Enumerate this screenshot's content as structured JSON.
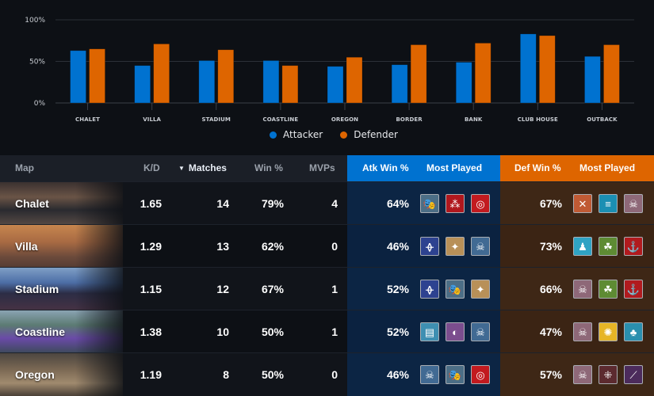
{
  "chart": {
    "legend": [
      {
        "label": "Attacker",
        "color": "#0072d0"
      },
      {
        "label": "Defender",
        "color": "#de6500"
      }
    ]
  },
  "chart_data": {
    "type": "bar",
    "title": "",
    "xlabel": "",
    "ylabel": "",
    "ylim": [
      0,
      100
    ],
    "yticks": [
      "0%",
      "50%",
      "100%"
    ],
    "ytick_values": [
      0,
      50,
      100
    ],
    "grid": true,
    "legend_position": "bottom-center",
    "categories": [
      "CHALET",
      "VILLA",
      "STADIUM",
      "COASTLINE",
      "OREGON",
      "BORDER",
      "BANK",
      "CLUB HOUSE",
      "OUTBACK"
    ],
    "series": [
      {
        "name": "Attacker",
        "color": "#0072d0",
        "values": [
          63,
          45,
          51,
          51,
          44,
          46,
          49,
          83,
          56
        ]
      },
      {
        "name": "Defender",
        "color": "#de6500",
        "values": [
          65,
          71,
          64,
          45,
          55,
          70,
          72,
          81,
          70
        ]
      }
    ]
  },
  "table": {
    "headers": {
      "map": "Map",
      "kd": "K/D",
      "sort_arrow": "▼",
      "matches": "Matches",
      "win": "Win %",
      "mvps": "MVPs",
      "atk_win": "Atk Win %",
      "atk_most": "Most Played",
      "def_win": "Def Win %",
      "def_most": "Most Played"
    },
    "colors": {
      "attack": "#0072d0",
      "defense": "#de6500"
    },
    "rows": [
      {
        "map": "Chalet",
        "kd": "1.65",
        "matches": "14",
        "win": "79%",
        "mvps": "4",
        "atk_win": "64%",
        "def_win": "67%",
        "atk_ops": [
          {
            "name": "masks-operator-icon",
            "glyph": "🎭",
            "bg": "#4c6e86"
          },
          {
            "name": "cluster-charge-operator-icon",
            "glyph": "⁂",
            "bg": "#b0171d"
          },
          {
            "name": "target-operator-icon",
            "glyph": "◎",
            "bg": "#c21a1f"
          }
        ],
        "def_ops": [
          {
            "name": "slash-operator-icon",
            "glyph": "✕",
            "bg": "#c05a34"
          },
          {
            "name": "zipper-operator-icon",
            "glyph": "≡",
            "bg": "#1b8fb3"
          },
          {
            "name": "skull-operator-icon",
            "glyph": "☠",
            "bg": "#8e6878"
          }
        ]
      },
      {
        "map": "Villa",
        "kd": "1.29",
        "matches": "13",
        "win": "62%",
        "mvps": "0",
        "atk_win": "46%",
        "def_win": "73%",
        "atk_ops": [
          {
            "name": "fingerprint-operator-icon",
            "glyph": "ᚖ",
            "bg": "#2d4290"
          },
          {
            "name": "compass-operator-icon",
            "glyph": "✦",
            "bg": "#b89058"
          },
          {
            "name": "drone-skull-operator-icon",
            "glyph": "☠",
            "bg": "#416a93"
          }
        ],
        "def_ops": [
          {
            "name": "silhouette-operator-icon",
            "glyph": "♟",
            "bg": "#2fa3c4"
          },
          {
            "name": "triquetra-operator-icon",
            "glyph": "☘",
            "bg": "#5e8b33"
          },
          {
            "name": "anchor-operator-icon",
            "glyph": "⚓",
            "bg": "#b11a1e"
          }
        ]
      },
      {
        "map": "Stadium",
        "kd": "1.15",
        "matches": "12",
        "win": "67%",
        "mvps": "1",
        "atk_win": "52%",
        "def_win": "66%",
        "atk_ops": [
          {
            "name": "fingerprint-operator-icon",
            "glyph": "ᚖ",
            "bg": "#2d4290"
          },
          {
            "name": "masks-operator-icon",
            "glyph": "🎭",
            "bg": "#4c6e86"
          },
          {
            "name": "compass-operator-icon",
            "glyph": "✦",
            "bg": "#b89058"
          }
        ],
        "def_ops": [
          {
            "name": "skull-operator-icon",
            "glyph": "☠",
            "bg": "#8e6878"
          },
          {
            "name": "triquetra-operator-icon",
            "glyph": "☘",
            "bg": "#5e8b33"
          },
          {
            "name": "anchor-operator-icon",
            "glyph": "⚓",
            "bg": "#b11a1e"
          }
        ]
      },
      {
        "map": "Coastline",
        "kd": "1.38",
        "matches": "10",
        "win": "50%",
        "mvps": "1",
        "atk_win": "52%",
        "def_win": "47%",
        "atk_ops": [
          {
            "name": "card-operator-icon",
            "glyph": "▤",
            "bg": "#3e8fb2"
          },
          {
            "name": "profile-operator-icon",
            "glyph": "◐",
            "bg": "#7b4d8e"
          },
          {
            "name": "drone-skull-operator-icon",
            "glyph": "☠",
            "bg": "#416a93"
          }
        ],
        "def_ops": [
          {
            "name": "skull-operator-icon",
            "glyph": "☠",
            "bg": "#8e6878"
          },
          {
            "name": "web-operator-icon",
            "glyph": "✺",
            "bg": "#e6b526"
          },
          {
            "name": "tree-operator-icon",
            "glyph": "♣",
            "bg": "#2a8fae"
          }
        ]
      },
      {
        "map": "Oregon",
        "kd": "1.19",
        "matches": "8",
        "win": "50%",
        "mvps": "0",
        "atk_win": "46%",
        "def_win": "57%",
        "atk_ops": [
          {
            "name": "drone-skull-operator-icon",
            "glyph": "☠",
            "bg": "#416a93"
          },
          {
            "name": "masks-operator-icon",
            "glyph": "🎭",
            "bg": "#4c6e86"
          },
          {
            "name": "target-operator-icon",
            "glyph": "◎",
            "bg": "#c21a1f"
          }
        ],
        "def_ops": [
          {
            "name": "skull-operator-icon",
            "glyph": "☠",
            "bg": "#8e6878"
          },
          {
            "name": "shield-dots-operator-icon",
            "glyph": "⁜",
            "bg": "#5c2a2f"
          },
          {
            "name": "blade-operator-icon",
            "glyph": "⟋",
            "bg": "#4c2b5c"
          }
        ]
      }
    ]
  }
}
